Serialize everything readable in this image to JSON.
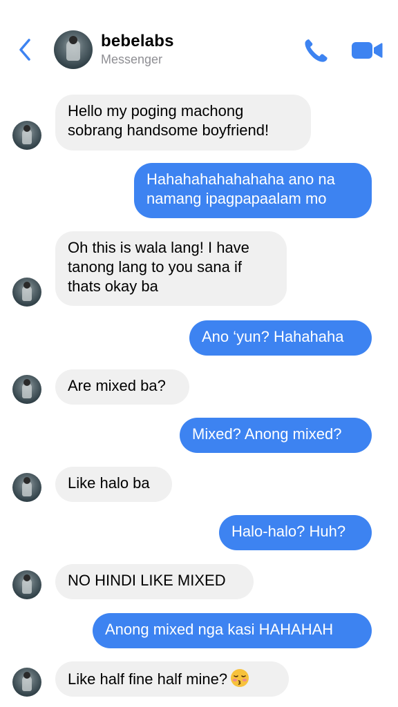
{
  "header": {
    "contact_name": "bebelabs",
    "subtitle": "Messenger",
    "accent_color": "#3d83f1",
    "icons": [
      "back-chevron-icon",
      "phone-icon",
      "video-camera-icon"
    ]
  },
  "messages": [
    {
      "from": "them",
      "text": "Hello my poging machong\nsobrang handsome boyfriend!"
    },
    {
      "from": "me",
      "text": "Hahahahahahahaha ano na\nnamang ipagpapaalam mo"
    },
    {
      "from": "them",
      "text": "Oh this is wala lang! I have\ntanong lang to you sana if\nthats okay ba"
    },
    {
      "from": "me",
      "text": "Ano ‘yun? Hahahaha"
    },
    {
      "from": "them",
      "text": "Are mixed ba?"
    },
    {
      "from": "me",
      "text": "Mixed? Anong mixed?"
    },
    {
      "from": "them",
      "text": "Like halo ba"
    },
    {
      "from": "me",
      "text": "Halo-halo? Huh?"
    },
    {
      "from": "them",
      "text": "NO HINDI LIKE MIXED"
    },
    {
      "from": "me",
      "text": "Anong mixed nga kasi HAHAHAH"
    },
    {
      "from": "them",
      "text": "Like half fine half mine?",
      "emoji": "kissing-face-closed-eyes-emoji"
    }
  ]
}
